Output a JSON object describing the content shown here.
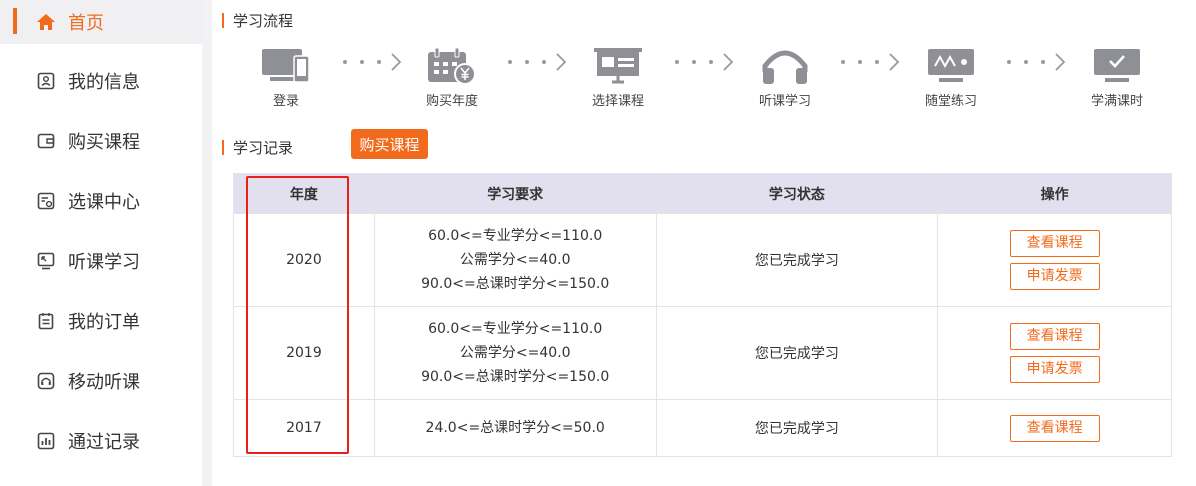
{
  "sidebar": {
    "items": [
      {
        "label": "首页",
        "icon": "home-icon"
      },
      {
        "label": "我的信息",
        "icon": "profile-card-icon"
      },
      {
        "label": "购买课程",
        "icon": "wallet-icon"
      },
      {
        "label": "选课中心",
        "icon": "course-select-icon"
      },
      {
        "label": "听课学习",
        "icon": "monitor-study-icon"
      },
      {
        "label": "我的订单",
        "icon": "order-list-icon"
      },
      {
        "label": "移动听课",
        "icon": "headphone-icon"
      },
      {
        "label": "通过记录",
        "icon": "bar-chart-icon"
      }
    ]
  },
  "process": {
    "title": "学习流程",
    "steps": [
      {
        "label": "登录",
        "icon": "computer-phone-icon"
      },
      {
        "label": "购买年度",
        "icon": "calendar-yuan-icon"
      },
      {
        "label": "选择课程",
        "icon": "presentation-board-icon"
      },
      {
        "label": "听课学习",
        "icon": "headphones-icon"
      },
      {
        "label": "随堂练习",
        "icon": "monitor-wave-icon"
      },
      {
        "label": "学满课时",
        "icon": "monitor-check-icon"
      }
    ]
  },
  "records": {
    "title": "学习记录",
    "buy_button": "购买课程",
    "columns": [
      "年度",
      "学习要求",
      "学习状态",
      "操作"
    ],
    "rows": [
      {
        "year": "2020",
        "req": [
          "60.0<=专业学分<=110.0",
          "公需学分<=40.0",
          "90.0<=总课时学分<=150.0"
        ],
        "status": "您已完成学习",
        "actions": [
          "查看课程",
          "申请发票"
        ]
      },
      {
        "year": "2019",
        "req": [
          "60.0<=专业学分<=110.0",
          "公需学分<=40.0",
          "90.0<=总课时学分<=150.0"
        ],
        "status": "您已完成学习",
        "actions": [
          "查看课程",
          "申请发票"
        ]
      },
      {
        "year": "2017",
        "req": [
          "24.0<=总课时学分<=50.0"
        ],
        "status": "您已完成学习",
        "actions": [
          "查看课程"
        ]
      }
    ]
  },
  "colors": {
    "accent": "#f26b1d",
    "header_bg": "#e2dfee",
    "highlight": "#e6211c",
    "icon_gray": "#8f8f96"
  }
}
